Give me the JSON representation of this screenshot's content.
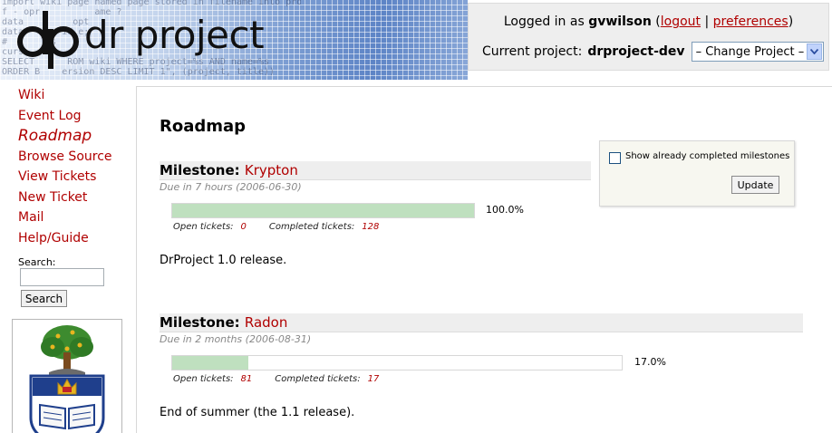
{
  "header": {
    "logo_text": "dr project",
    "logo_background_text": "import wiki page named page stored in filename into project\nf - opr          ame ?\ndata         opt\ndata       id e;\n#      lds\ncurs\nSELECT      ROM wiki WHERE project=%s AND name=%s\nORDER B    ersion DESC LIMIT 1\", (project, title))",
    "login_prefix": "Logged in as",
    "username": "gvwilson",
    "logout_label": "logout",
    "separator": "|",
    "preferences_label": "preferences",
    "project_prefix": "Current project:",
    "project_name": "drproject-dev",
    "change_project_value": "– Change Project –"
  },
  "sidebar": {
    "items": [
      {
        "label": "Wiki"
      },
      {
        "label": "Event Log"
      },
      {
        "label": "Roadmap"
      },
      {
        "label": "Browse Source"
      },
      {
        "label": "View Tickets"
      },
      {
        "label": "New Ticket"
      },
      {
        "label": "Mail"
      },
      {
        "label": "Help/Guide"
      }
    ],
    "active_item": "Roadmap",
    "search_label": "Search:",
    "search_value": "",
    "search_button": "Search"
  },
  "main": {
    "title": "Roadmap",
    "filter": {
      "checkbox_label": "Show already completed milestones",
      "checked": false,
      "update_button": "Update"
    },
    "milestones": [
      {
        "prefix": "Milestone:",
        "name": "Krypton",
        "due": "Due in 7 hours (2006-06-30)",
        "progress": 1.0,
        "percent_label": "100.0%",
        "open_label": "Open tickets:",
        "open_count": "0",
        "completed_label": "Completed tickets:",
        "completed_count": "128",
        "description": "DrProject 1.0 release."
      },
      {
        "prefix": "Milestone:",
        "name": "Radon",
        "due": "Due in 2 months (2006-08-31)",
        "progress": 0.17,
        "percent_label": "17.0%",
        "open_label": "Open tickets:",
        "open_count": "81",
        "completed_label": "Completed tickets:",
        "completed_count": "17",
        "description": "End of summer (the 1.1 release)."
      }
    ]
  },
  "colors": {
    "link": "#b00000",
    "progress_fill": "#bfe0bf",
    "account_box": "#eeeeee"
  },
  "icons": {
    "dropdown": "chevron-down-icon",
    "logo": "dp-logo-icon",
    "crest": "university-crest-icon"
  }
}
